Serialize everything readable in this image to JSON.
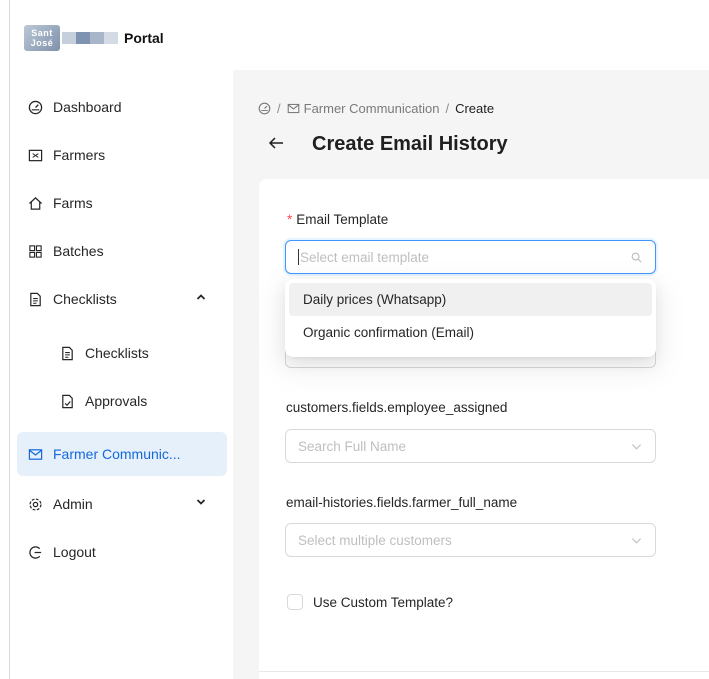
{
  "brand": {
    "logo_text_top": "Sant",
    "logo_text_bottom": "José",
    "app_name": "Portal"
  },
  "sidebar": {
    "items": [
      {
        "label": "Dashboard",
        "icon": "dashboard-icon"
      },
      {
        "label": "Farmers",
        "icon": "id-card-icon"
      },
      {
        "label": "Farms",
        "icon": "home-icon"
      },
      {
        "label": "Batches",
        "icon": "grid-icon"
      },
      {
        "label": "Checklists",
        "icon": "file-icon",
        "expanded": true
      },
      {
        "label": "Checklists",
        "icon": "file-icon",
        "sub": true
      },
      {
        "label": "Approvals",
        "icon": "file-check-icon",
        "sub": true
      },
      {
        "label": "Farmer Communic...",
        "icon": "mail-icon",
        "active": true
      },
      {
        "label": "Admin",
        "icon": "gear-icon",
        "expanded": false
      },
      {
        "label": "Logout",
        "icon": "logout-icon"
      }
    ]
  },
  "breadcrumb": {
    "separator": "/",
    "items": [
      "Farmer Communication",
      "Create"
    ]
  },
  "page": {
    "title": "Create Email History"
  },
  "form": {
    "email_template": {
      "label": "Email Template",
      "required_mark": "*",
      "placeholder": "Select email template",
      "options": [
        "Daily prices (Whatsapp)",
        "Organic confirmation (Email)"
      ]
    },
    "employee": {
      "label": "customers.fields.employee_assigned",
      "placeholder": "Search Full Name"
    },
    "farmer": {
      "label": "email-histories.fields.farmer_full_name",
      "placeholder": "Select multiple customers"
    },
    "custom_template": {
      "label": "Use Custom Template?",
      "checked": false
    }
  },
  "colors": {
    "primary": "#1668dc",
    "active_bg": "#e6f0fb",
    "required": "#ff4d4f",
    "focus_border": "#4096ff"
  }
}
